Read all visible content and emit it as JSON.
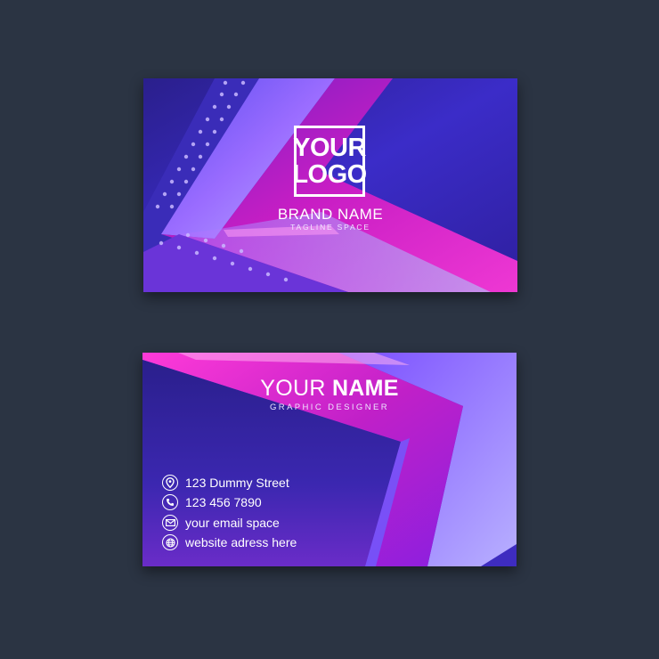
{
  "colors": {
    "background": "#2b3443",
    "card_deep": "#2a1f8c",
    "card_violet": "#8a3cf0",
    "card_magenta": "#e020c8",
    "card_lavender": "#a89cff"
  },
  "front": {
    "logo_line1": "YOUR",
    "logo_line2": "LOGO",
    "brand_name": "BRAND NAME",
    "tagline": "TAGLINE SPACE"
  },
  "back": {
    "name_first": "YOUR",
    "name_last": "NAME",
    "title": "GRAPHIC DESIGNER",
    "contacts": [
      {
        "icon": "location-pin-icon",
        "text": "123 Dummy Street"
      },
      {
        "icon": "phone-icon",
        "text": "123 456 7890"
      },
      {
        "icon": "email-icon",
        "text": "your email space"
      },
      {
        "icon": "globe-icon",
        "text": "website adress here"
      }
    ]
  }
}
